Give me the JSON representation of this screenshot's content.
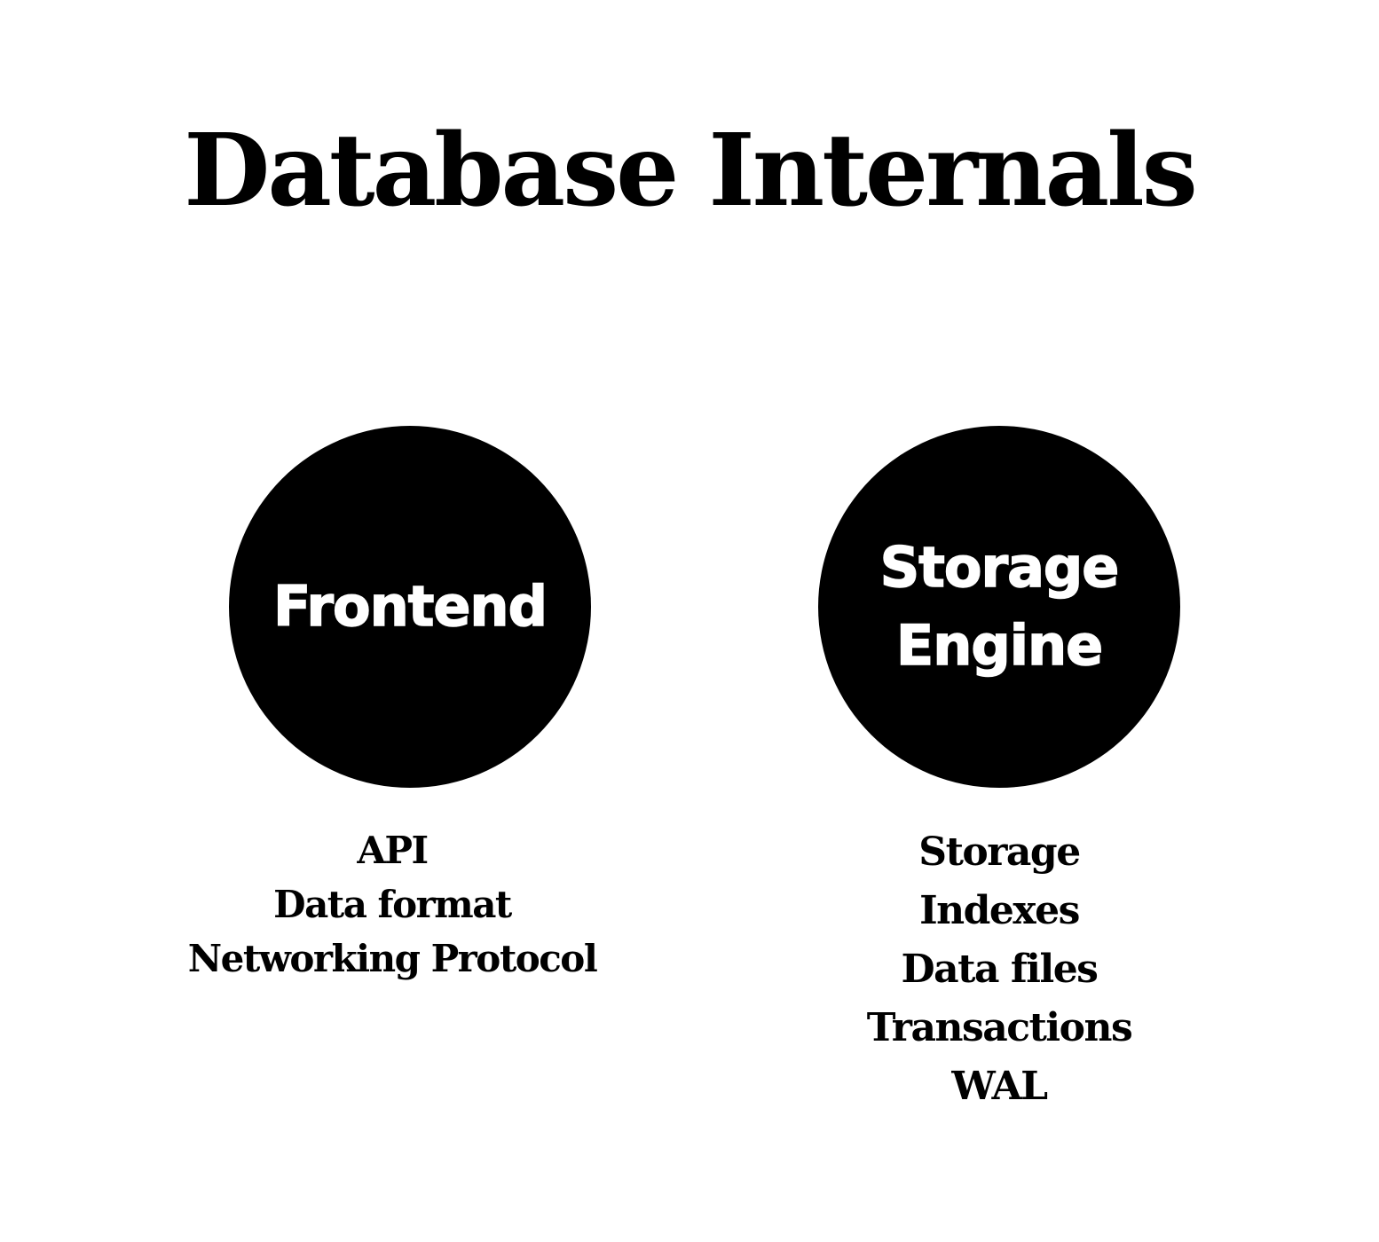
{
  "title": "Database Internals",
  "nodes": [
    {
      "label_lines": [
        "Frontend"
      ],
      "items": [
        "API",
        "Data format",
        "Networking Protocol"
      ]
    },
    {
      "label_lines": [
        "Storage",
        "Engine"
      ],
      "items": [
        "Storage",
        "Indexes",
        "Data files",
        "Transactions",
        "WAL"
      ]
    }
  ],
  "colors": {
    "background": "#ffffff",
    "circle_fill": "#000000",
    "circle_text": "#ffffff",
    "text": "#000000"
  }
}
